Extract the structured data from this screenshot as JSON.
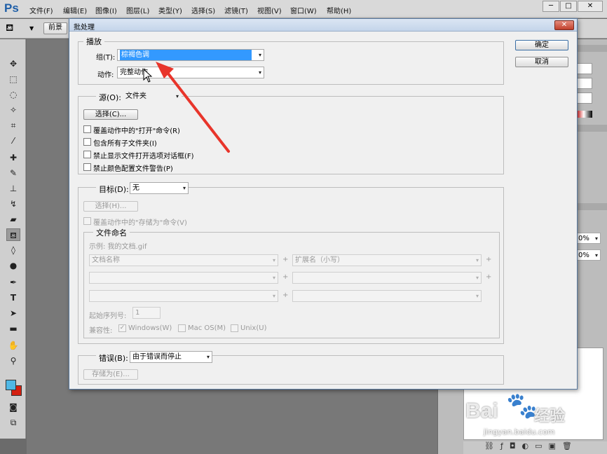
{
  "app": {
    "logo": "Ps",
    "menu": [
      "文件(F)",
      "编辑(E)",
      "图像(I)",
      "图层(L)",
      "类型(Y)",
      "选择(S)",
      "滤镜(T)",
      "视图(V)",
      "窗口(W)",
      "帮助(H)"
    ],
    "options_bar": {
      "preset_label": "前景"
    }
  },
  "dialog": {
    "title": "批处理",
    "ok_label": "确定",
    "cancel_label": "取消",
    "play": {
      "legend": "播放",
      "set_label": "组(T):",
      "set_value": "棕褐色调",
      "action_label": "动作:",
      "action_value": "完整动作"
    },
    "source": {
      "label": "源(O):",
      "value": "文件夹",
      "choose_label": "选择(C)...",
      "options": [
        "覆盖动作中的\"打开\"命令(R)",
        "包含所有子文件夹(I)",
        "禁止显示文件打开选项对话框(F)",
        "禁止颜色配置文件警告(P)"
      ]
    },
    "destination": {
      "label": "目标(D):",
      "value": "无",
      "choose_label": "选择(H)...",
      "override_save": "覆盖动作中的\"存储为\"命令(V)",
      "naming": {
        "legend": "文件命名",
        "example": "示例: 我的文档.gif",
        "field1": "文档名称",
        "field2": "扩展名（小写）",
        "plus": "+",
        "serial_label": "起始序列号:",
        "serial_value": "1",
        "compat_label": "兼容性:",
        "compat_options": [
          "Windows(W)",
          "Mac OS(M)",
          "Unix(U)"
        ]
      }
    },
    "errors": {
      "label": "错误(B):",
      "value": "由于错误而停止",
      "save_as_label": "存储为(E)..."
    }
  },
  "watermark": {
    "brand": "Bai",
    "brand_cn": "经验",
    "url": "jingyan.baidu.com"
  },
  "colors": {
    "highlight": "#3399ff",
    "arrow": "#e8352b",
    "fg_swatch": "#4fb8e6",
    "bg_swatch": "#d42010"
  }
}
